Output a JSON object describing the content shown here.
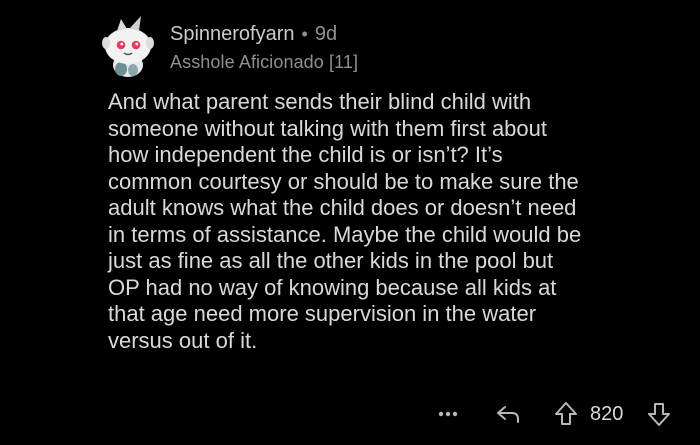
{
  "comment": {
    "author": "Spinnerofyarn",
    "separator": "•",
    "age": "9d",
    "flair": "Asshole Aficionado [11]",
    "body": "And what parent sends their blind child with\nsomeone without talking with them first about\nhow independent the child is or isn’t? It’s\ncommon courtesy or should be to make sure the\nadult knows what the child does or doesn’t need\nin terms of assistance. Maybe the child would be\njust as fine as all the other kids in the pool but\nOP had no way of knowing because all kids at\nthat age need more supervision in the water\nversus out of it.",
    "score": "820",
    "avatar_icon": "snoo-avatar-icon"
  },
  "actions": {
    "more_icon": "more-dots-icon",
    "reply_icon": "reply-arrow-icon",
    "upvote_icon": "upvote-arrow-icon",
    "downvote_icon": "downvote-arrow-icon"
  },
  "colors": {
    "background": "#000000",
    "text": "#d7dadc",
    "muted": "#8e9194"
  }
}
